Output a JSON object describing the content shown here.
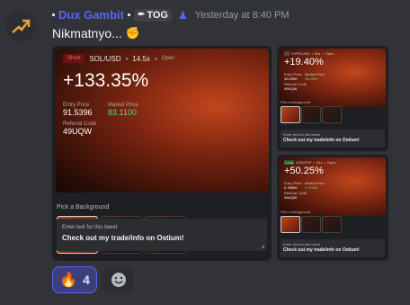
{
  "author": {
    "name": "Dux Gambit",
    "clan_tag": "TOG",
    "timestamp": "Yesterday at 8:40 PM",
    "avatar_icon": "arrow-up-icon"
  },
  "message": {
    "text": "Nikmatnyo..."
  },
  "main_card": {
    "side": "Short",
    "pair": "SOL/USD",
    "leverage": "14.5x",
    "status": "Open",
    "pnl": "+133.35%",
    "entry_label": "Entry Price",
    "entry_value": "91.5396",
    "market_label": "Market Price",
    "market_value": "83.1100",
    "referral_label": "Referral Code",
    "referral_value": "49UQW",
    "pick_label": "Pick a Background",
    "tweet_label": "Enter text for this tweet",
    "tweet_text": "Check out my trade/info on Ostium!"
  },
  "card_top": {
    "pair": "HYPE/USD",
    "leverage": "50x",
    "status": "Open",
    "pnl": "+19.40%",
    "entry_label": "Entry Price",
    "entry_value": "39.0390",
    "market_label": "Market Price",
    "market_value": "38.0009",
    "referral_label": "Referral Code",
    "referral_value": "49UQW",
    "pick_label": "Pick a Background",
    "tweet_label": "Enter text for this tweet",
    "tweet_text": "Check out my trade/info on Ostium!"
  },
  "card_bottom": {
    "side": "Long",
    "pair": "USD/CHF",
    "leverage": "51x",
    "status": "Open",
    "pnl": "+50.25%",
    "entry_label": "Entry Price",
    "entry_value": "0.78690",
    "market_label": "Market Price",
    "market_value": "0.79465",
    "referral_label": "Referral Code",
    "referral_value": "49UQW",
    "pick_label": "Pick a Background",
    "tweet_label": "Enter text for this tweet",
    "tweet_text": "Check out my trade/info on Ostium!"
  },
  "reactions": [
    {
      "emoji": "🔥",
      "count": "4"
    }
  ],
  "colors": {
    "username": "#5865f2",
    "accent": "#c2461d",
    "green": "#4ade80",
    "background": "#313338"
  }
}
